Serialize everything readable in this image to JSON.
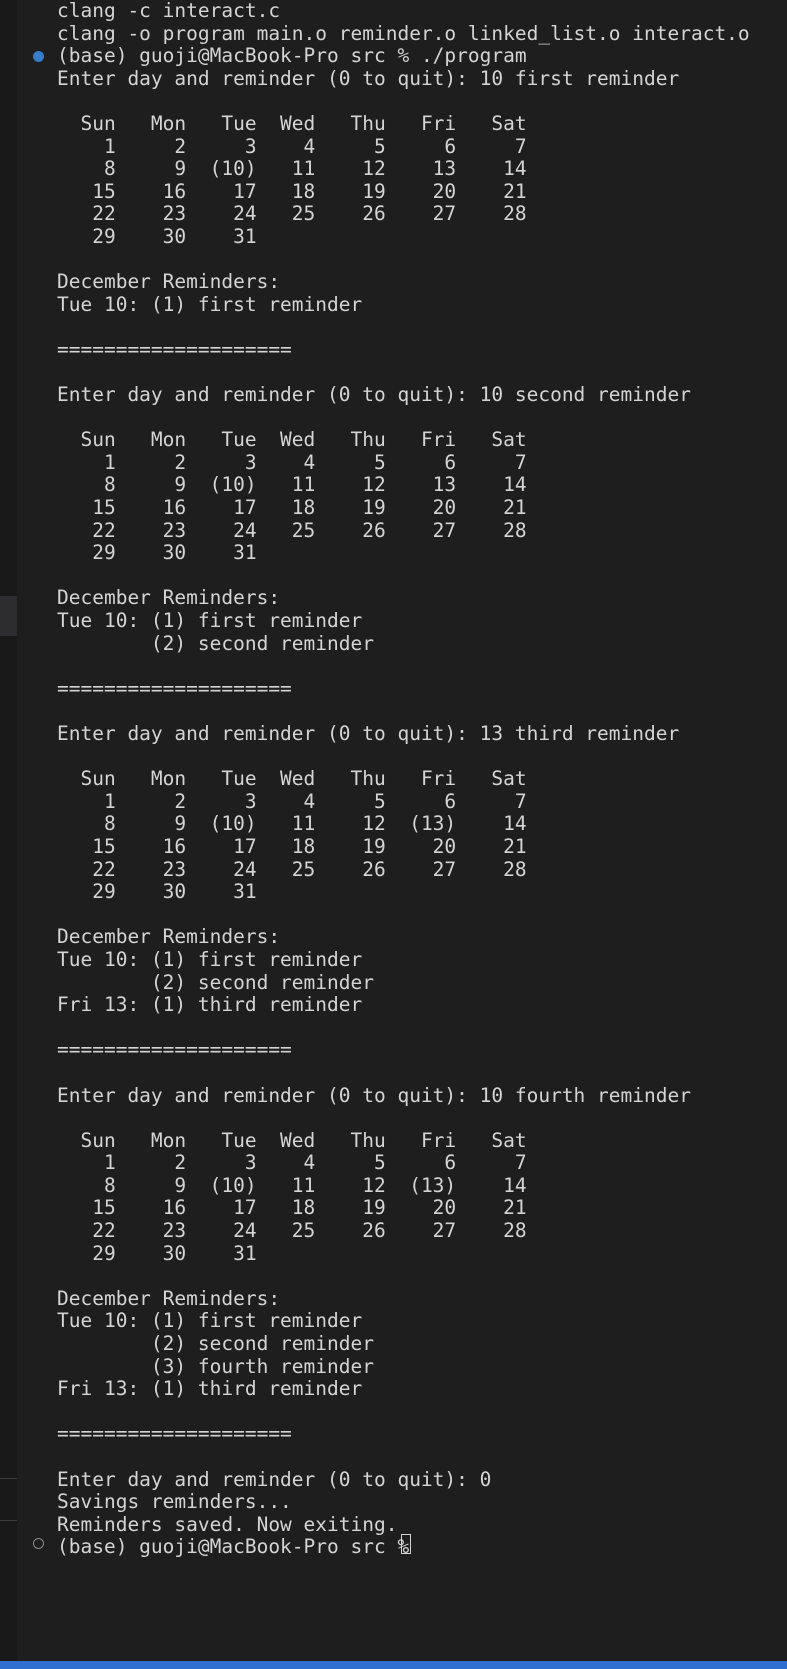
{
  "terminal": {
    "lines": [
      "clang -c interact.c",
      "clang -o program main.o reminder.o linked_list.o interact.o",
      "(base) guoji@MacBook-Pro src % ./program",
      "Enter day and reminder (0 to quit): 10 first reminder",
      "",
      "  Sun   Mon   Tue  Wed   Thu   Fri   Sat",
      "    1     2     3    4     5     6     7",
      "    8     9  (10)   11    12    13    14",
      "   15    16    17   18    19    20    21",
      "   22    23    24   25    26    27    28",
      "   29    30    31",
      "",
      "December Reminders:",
      "Tue 10: (1) first reminder",
      "",
      "====================",
      "",
      "Enter day and reminder (0 to quit): 10 second reminder",
      "",
      "  Sun   Mon   Tue  Wed   Thu   Fri   Sat",
      "    1     2     3    4     5     6     7",
      "    8     9  (10)   11    12    13    14",
      "   15    16    17   18    19    20    21",
      "   22    23    24   25    26    27    28",
      "   29    30    31",
      "",
      "December Reminders:",
      "Tue 10: (1) first reminder",
      "        (2) second reminder",
      "",
      "====================",
      "",
      "Enter day and reminder (0 to quit): 13 third reminder",
      "",
      "  Sun   Mon   Tue  Wed   Thu   Fri   Sat",
      "    1     2     3    4     5     6     7",
      "    8     9  (10)   11    12  (13)    14",
      "   15    16    17   18    19    20    21",
      "   22    23    24   25    26    27    28",
      "   29    30    31",
      "",
      "December Reminders:",
      "Tue 10: (1) first reminder",
      "        (2) second reminder",
      "Fri 13: (1) third reminder",
      "",
      "====================",
      "",
      "Enter day and reminder (0 to quit): 10 fourth reminder",
      "",
      "  Sun   Mon   Tue  Wed   Thu   Fri   Sat",
      "    1     2     3    4     5     6     7",
      "    8     9  (10)   11    12  (13)    14",
      "   15    16    17   18    19    20    21",
      "   22    23    24   25    26    27    28",
      "   29    30    31",
      "",
      "December Reminders:",
      "Tue 10: (1) first reminder",
      "        (2) second reminder",
      "        (3) fourth reminder",
      "Fri 13: (1) third reminder",
      "",
      "====================",
      "",
      "Enter day and reminder (0 to quit): 0",
      "Savings reminders...",
      "Reminders saved. Now exiting.",
      "(base) guoji@MacBook-Pro src % "
    ]
  },
  "decorations": {
    "command_success_icon": "circle-filled-blue",
    "command_pending_icon": "circle-hollow"
  },
  "colors": {
    "background": "#1e1e1e",
    "foreground": "#d4d4d4",
    "accent": "#2f6fd0"
  }
}
